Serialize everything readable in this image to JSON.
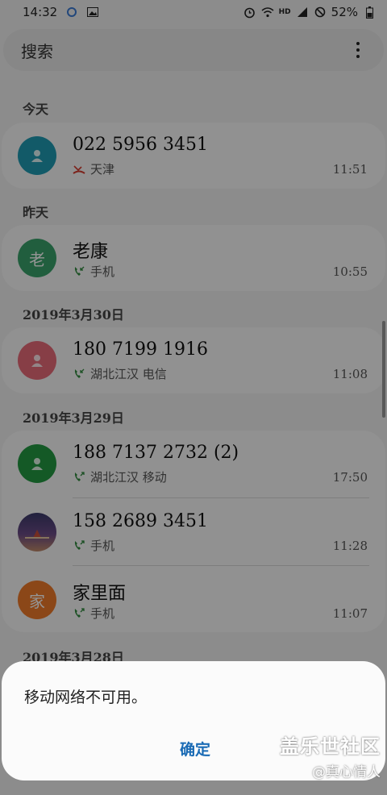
{
  "status_bar": {
    "time": "14:32",
    "battery": "52%",
    "network_label": "HD"
  },
  "search": {
    "placeholder": "搜索"
  },
  "sections": [
    {
      "header": "今天"
    },
    {
      "header": "昨天"
    },
    {
      "header": "2019年3月30日"
    },
    {
      "header": "2019年3月29日"
    },
    {
      "header": "2019年3月28日"
    }
  ],
  "calls": [
    {
      "name": "022 5956 3451",
      "location": "天津",
      "time": "11:51",
      "avatar": "",
      "avatar_color": "#1f9bb3",
      "call_type": "missed"
    },
    {
      "name": "老康",
      "location": "手机",
      "time": "10:55",
      "avatar": "老",
      "avatar_color": "#3aa36b",
      "call_type": "incoming"
    },
    {
      "name": "180 7199 1916",
      "location": "湖北江汉 电信",
      "time": "11:08",
      "avatar": "",
      "avatar_color": "#e96b79",
      "call_type": "incoming"
    },
    {
      "name": "188 7137 2732 (2)",
      "location": "湖北江汉 移动",
      "time": "17:50",
      "avatar": "",
      "avatar_color": "#239a43",
      "call_type": "outgoing"
    },
    {
      "name": "158 2689 3451",
      "location": "手机",
      "time": "11:28",
      "avatar": "",
      "avatar_color": "#6b4b87",
      "call_type": "outgoing"
    },
    {
      "name": "家里面",
      "location": "手机",
      "time": "11:07",
      "avatar": "家",
      "avatar_color": "#f07a2a",
      "call_type": "outgoing"
    }
  ],
  "dialog": {
    "message": "移动网络不可用。",
    "ok_label": "确定"
  },
  "watermark": {
    "brand": "盖乐世社区",
    "user": "@真心情人"
  },
  "colors": {
    "accent": "#1a6bb5",
    "missed": "#d63c2f",
    "call_icon": "#2f8a3d"
  }
}
